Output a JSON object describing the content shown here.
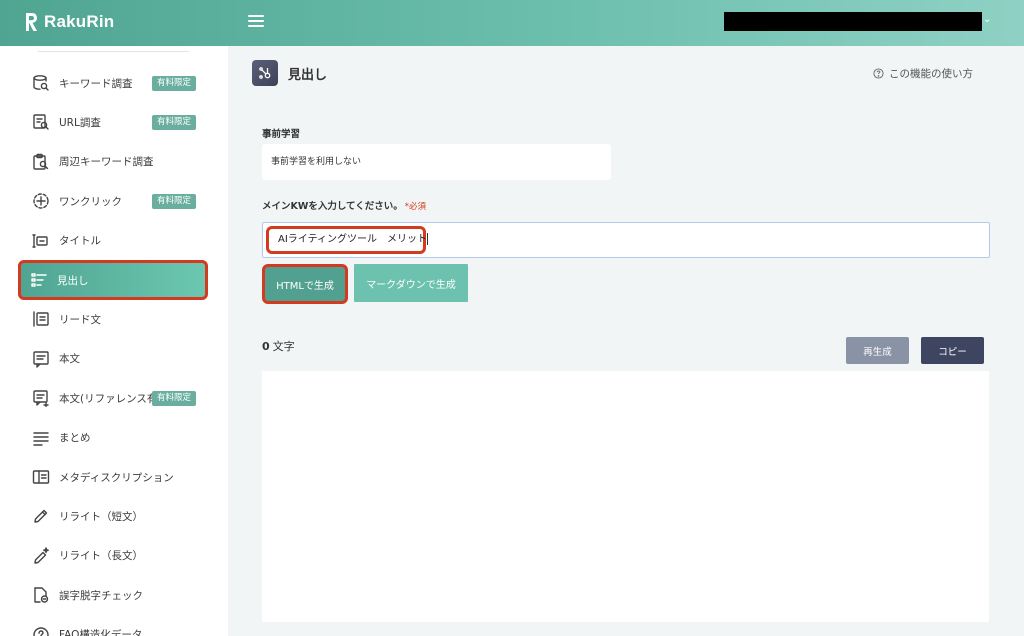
{
  "app": {
    "name": "RakuRin"
  },
  "colors": {
    "accent": "#5aae9c",
    "highlight_border": "#d43a1f",
    "badge": "#6aaea0"
  },
  "sidebar": {
    "items": [
      {
        "label": "キーワード調査",
        "icon": "keyword-research-icon",
        "badge": "有料限定",
        "active": false
      },
      {
        "label": "URL調査",
        "icon": "url-research-icon",
        "badge": "有料限定",
        "active": false
      },
      {
        "label": "周辺キーワード調査",
        "icon": "related-keyword-icon",
        "badge": "",
        "active": false
      },
      {
        "label": "ワンクリック",
        "icon": "one-click-icon",
        "badge": "有料限定",
        "active": false
      },
      {
        "label": "タイトル",
        "icon": "title-icon",
        "badge": "",
        "active": false
      },
      {
        "label": "見出し",
        "icon": "headings-icon",
        "badge": "",
        "active": true
      },
      {
        "label": "リード文",
        "icon": "lead-text-icon",
        "badge": "",
        "active": false
      },
      {
        "label": "本文",
        "icon": "body-text-icon",
        "badge": "",
        "active": false
      },
      {
        "label": "本文(リファレンス有)",
        "icon": "body-reference-icon",
        "badge": "有料限定",
        "active": false
      },
      {
        "label": "まとめ",
        "icon": "summary-icon",
        "badge": "",
        "active": false
      },
      {
        "label": "メタディスクリプション",
        "icon": "meta-description-icon",
        "badge": "",
        "active": false
      },
      {
        "label": "リライト（短文）",
        "icon": "rewrite-short-icon",
        "badge": "",
        "active": false
      },
      {
        "label": "リライト（長文）",
        "icon": "rewrite-long-icon",
        "badge": "",
        "active": false
      },
      {
        "label": "誤字脱字チェック",
        "icon": "typo-check-icon",
        "badge": "",
        "active": false
      },
      {
        "label": "FAQ構造化データ",
        "icon": "faq-structured-data-icon",
        "badge": "",
        "active": false
      }
    ]
  },
  "main": {
    "title": "見出し",
    "help_label": "この機能の使い方",
    "pretraining": {
      "label": "事前学習",
      "value": "事前学習を利用しない"
    },
    "keyword": {
      "label": "メインKWを入力してください。",
      "required": "*必須",
      "value": "AIライティングツール　メリット"
    },
    "buttons": {
      "html": "HTMLで生成",
      "markdown": "マークダウンで生成",
      "regenerate": "再生成",
      "copy": "コピー"
    },
    "char_count": {
      "value": "0",
      "unit": "文字"
    }
  }
}
